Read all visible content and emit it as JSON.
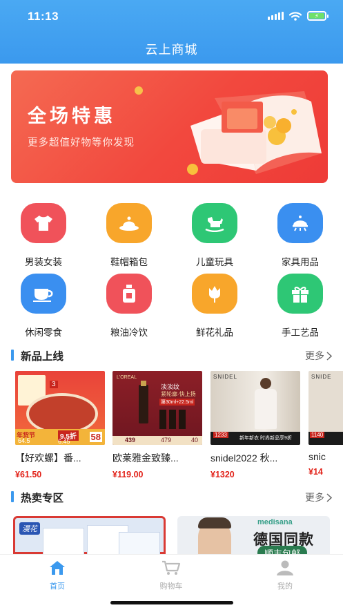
{
  "status_bar": {
    "time": "11:13"
  },
  "header": {
    "title": "云上商城"
  },
  "banner": {
    "title": "全场特惠",
    "subtitle": "更多超值好物等你发现"
  },
  "categories": [
    {
      "label": "男装女装",
      "icon": "shirt-icon",
      "color": "#f0525a"
    },
    {
      "label": "鞋帽箱包",
      "icon": "hat-icon",
      "color": "#f8a62b"
    },
    {
      "label": "儿童玩具",
      "icon": "rocking-horse-icon",
      "color": "#2ec775"
    },
    {
      "label": "家具用品",
      "icon": "lamp-icon",
      "color": "#3a8ff0"
    },
    {
      "label": "休闲零食",
      "icon": "cup-icon",
      "color": "#3a8ff0"
    },
    {
      "label": "粮油冷饮",
      "icon": "bottle-icon",
      "color": "#f0525a"
    },
    {
      "label": "鲜花礼品",
      "icon": "flower-icon",
      "color": "#f8a62b"
    },
    {
      "label": "手工艺品",
      "icon": "gift-icon",
      "color": "#2ec775"
    }
  ],
  "new_section": {
    "title": "新品上线",
    "more": "更多"
  },
  "products": [
    {
      "name": "【好欢螺】番...",
      "price": "¥61.50",
      "img_tags": [
        "3",
        "年货节",
        "9.5折",
        "64.5",
        "6.45",
        "58"
      ]
    },
    {
      "name": "欧莱雅金致臻...",
      "price": "¥119.00",
      "img_tags": [
        "L'OREAL",
        "淡淡纹",
        "紧轮廓·快上扬",
        "第30ml+22.5ml",
        "439",
        "479",
        "40"
      ]
    },
    {
      "name": "snidel2022 秋...",
      "price": "¥1320",
      "img_tags": [
        "SNIDEL",
        "1233",
        "新年新衣",
        "时尚新品享9折"
      ]
    },
    {
      "name": "snic",
      "price": "¥14",
      "img_tags": [
        "SNIDE",
        "1140"
      ]
    }
  ],
  "hot_section": {
    "title": "热卖专区",
    "more": "更多"
  },
  "hot_cards": [
    {
      "brand": "漫花"
    },
    {
      "brand": "medisana",
      "headline": "德国同款",
      "tag": "顺丰包邮"
    }
  ],
  "tabbar": [
    {
      "label": "首页",
      "icon": "home-icon",
      "active": true
    },
    {
      "label": "购物车",
      "icon": "cart-icon",
      "active": false
    },
    {
      "label": "我的",
      "icon": "user-icon",
      "active": false
    }
  ],
  "colors": {
    "primary": "#3b99ee",
    "price": "#e2231a",
    "banner": "#f2483e"
  }
}
